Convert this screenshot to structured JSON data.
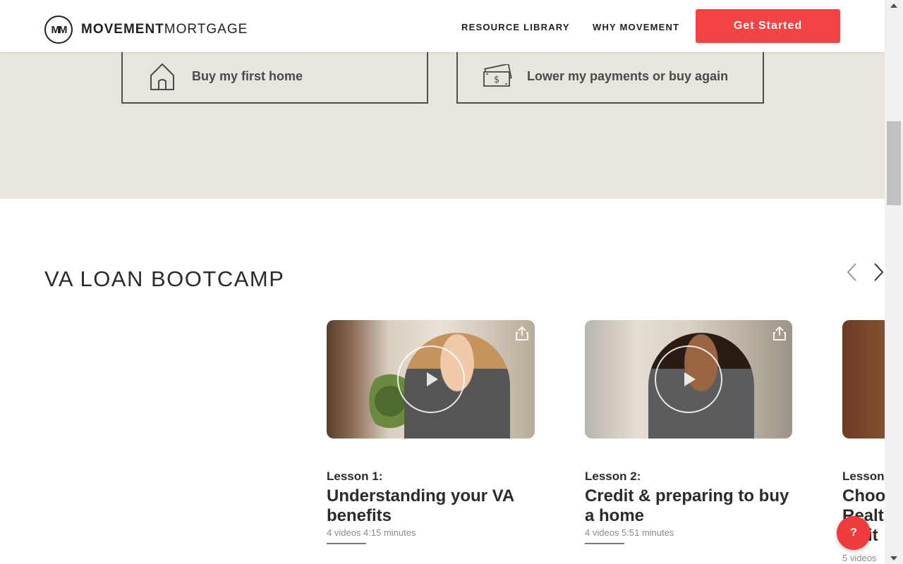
{
  "brand": {
    "logo_mark": "MM",
    "name_bold": "MOVEMENT",
    "name_light": "MORTGAGE"
  },
  "nav": {
    "resource_library": "RESOURCE LIBRARY",
    "why_movement": "WHY MOVEMENT",
    "cta": "Get Started"
  },
  "options": [
    {
      "label": "Buy my first home",
      "icon": "house-icon"
    },
    {
      "label": "Lower my payments or buy again",
      "icon": "cash-icon"
    }
  ],
  "section": {
    "title": "VA LOAN BOOTCAMP"
  },
  "lessons": [
    {
      "number": "Lesson 1:",
      "title": "Understanding your VA benefits",
      "meta": "4 videos 4:15 minutes"
    },
    {
      "number": "Lesson 2:",
      "title": "Credit & preparing to buy a home",
      "meta": "4 videos 5:51 minutes"
    },
    {
      "number": "Lesson",
      "title": "Choo Realt entit",
      "meta": "5 videos"
    }
  ],
  "help": {
    "label": "?"
  },
  "colors": {
    "accent": "#f24444",
    "beige": "#e9e5dd"
  }
}
